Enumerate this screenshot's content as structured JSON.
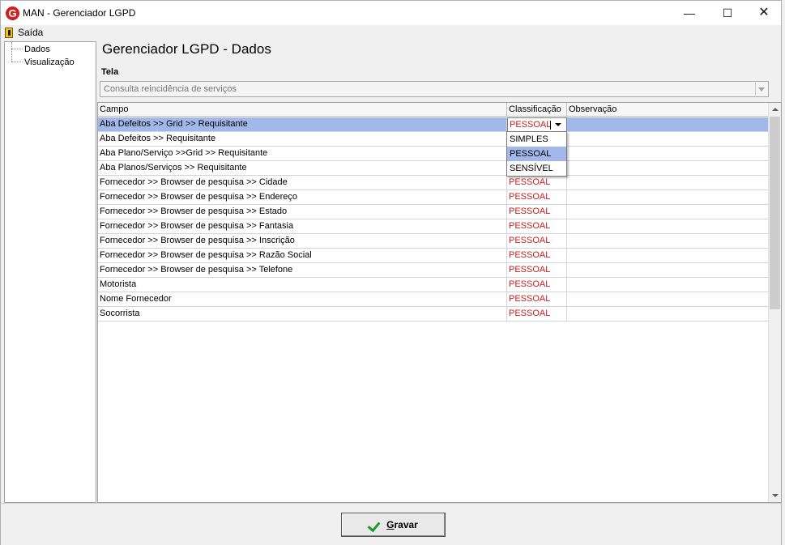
{
  "window": {
    "app_icon": "G",
    "title": "MAN - Gerenciador LGPD",
    "controls": {
      "minimize": "—",
      "maximize": "☐",
      "close": "✕"
    }
  },
  "menu": {
    "exit_label": "Saída"
  },
  "tree": {
    "items": [
      "Dados",
      "Visualização"
    ]
  },
  "main": {
    "title": "Gerenciador LGPD - Dados"
  },
  "tela": {
    "label": "Tela",
    "value": "Consulta reincidência de serviços"
  },
  "grid": {
    "headers": [
      "Campo",
      "Classificação",
      "Observação"
    ],
    "rows": [
      {
        "campo": "Aba Defeitos >> Grid >> Requisitante",
        "classificacao": "PESSOAL",
        "observacao": ""
      },
      {
        "campo": "Aba Defeitos >> Requisitante",
        "classificacao": "",
        "observacao": ""
      },
      {
        "campo": "Aba Plano/Serviço >>Grid >> Requisitante",
        "classificacao": "",
        "observacao": ""
      },
      {
        "campo": "Aba Planos/Serviços >> Requisitante",
        "classificacao": "",
        "observacao": ""
      },
      {
        "campo": "Fornecedor >> Browser de pesquisa >> Cidade",
        "classificacao": "PESSOAL",
        "observacao": ""
      },
      {
        "campo": "Fornecedor >> Browser de pesquisa >> Endereço",
        "classificacao": "PESSOAL",
        "observacao": ""
      },
      {
        "campo": "Fornecedor >> Browser de pesquisa >> Estado",
        "classificacao": "PESSOAL",
        "observacao": ""
      },
      {
        "campo": "Fornecedor >> Browser de pesquisa >> Fantasia",
        "classificacao": "PESSOAL",
        "observacao": ""
      },
      {
        "campo": "Fornecedor >> Browser de pesquisa >> Inscrição",
        "classificacao": "PESSOAL",
        "observacao": ""
      },
      {
        "campo": "Fornecedor >> Browser de pesquisa >> Razão Social",
        "classificacao": "PESSOAL",
        "observacao": ""
      },
      {
        "campo": "Fornecedor >> Browser de pesquisa >> Telefone",
        "classificacao": "PESSOAL",
        "observacao": ""
      },
      {
        "campo": "Motorista",
        "classificacao": "PESSOAL",
        "observacao": ""
      },
      {
        "campo": "Nome Fornecedor",
        "classificacao": "PESSOAL",
        "observacao": ""
      },
      {
        "campo": "Socorrista",
        "classificacao": "PESSOAL",
        "observacao": ""
      }
    ],
    "dropdown_options": [
      "SIMPLES",
      "PESSOAL",
      "SENSÍVEL"
    ],
    "dropdown_highlighted": "PESSOAL"
  },
  "footer": {
    "save_label_first": "G",
    "save_label_rest": "ravar",
    "save_icon": "check-icon"
  },
  "colors": {
    "selection": "#a3b8ea",
    "classification_text": "#c81e1e",
    "check": "#1c9b2a",
    "app_icon": "#d21f1f"
  }
}
